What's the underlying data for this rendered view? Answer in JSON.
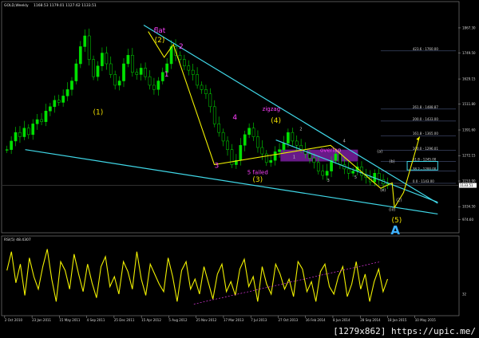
{
  "header": {
    "symbol": "GOLD,Weekly",
    "quote": "1168.53 1179.01 1127.62 1133.51",
    "osc": "RSI(5) 48.4307"
  },
  "watermark": "[1279x862] https://upic.me/",
  "colors": {
    "background": "#000000",
    "candle_up": "#00e000",
    "candle_down": "#00e000",
    "trendline": "#40d8e8",
    "wave": "#f0f000",
    "label_yellow": "#f0e000",
    "label_magenta": "#ff40ff",
    "label_gray": "#c8c8c8",
    "label_blue": "#3cb0ff",
    "overlap_box": "#7a1fa0",
    "osc_line": "#f0f000"
  },
  "chart_data": {
    "type": "candlestick",
    "title": "",
    "x_ticks": [
      "2 Oct 2010",
      "23 Jan 2011",
      "15 May 2011",
      "4 Sep 2011",
      "25 Dec 2011",
      "15 Apr 2012",
      "5 Aug 2012",
      "25 Nov 2012",
      "17 Mar 2013",
      "7 Jul 2013",
      "27 Oct 2013",
      "16 Feb 2014",
      "8 Jun 2014",
      "28 Sep 2014",
      "18 Jan 2015",
      "10 May 2015"
    ],
    "y_ticks": [
      1867.3,
      1749.5,
      1629.15,
      1511.8,
      1391.6,
      1272.15,
      1153.9,
      1034.5,
      974.6
    ],
    "ylim": [
      920,
      1960
    ],
    "current_price": 1133.51,
    "fib_levels": [
      {
        "label": "423.6",
        "value": 1760
      },
      {
        "label": "261.8",
        "value": 1488.87
      },
      {
        "label": "200.0",
        "value": 1433
      },
      {
        "label": "161.8",
        "value": 1365
      },
      {
        "label": "100.0",
        "value": 1296.01
      },
      {
        "label": "61.8",
        "value": 1245
      },
      {
        "label": "38.2",
        "value": 1200
      },
      {
        "label": "0.0",
        "value": 1143
      }
    ],
    "series": [
      {
        "name": "GOLD Weekly close",
        "values": [
          1300,
          1340,
          1380,
          1360,
          1400,
          1370,
          1420,
          1440,
          1430,
          1480,
          1500,
          1530,
          1520,
          1550,
          1580,
          1620,
          1700,
          1780,
          1830,
          1720,
          1640,
          1690,
          1750,
          1700,
          1650,
          1600,
          1620,
          1700,
          1740,
          1660,
          1650,
          1680,
          1640,
          1600,
          1580,
          1620,
          1660,
          1700,
          1780,
          1740,
          1720,
          1690,
          1670,
          1650,
          1600,
          1580,
          1560,
          1500,
          1420,
          1380,
          1340,
          1300,
          1230,
          1250,
          1320,
          1370,
          1400,
          1360,
          1310,
          1280,
          1240,
          1250,
          1290,
          1300,
          1330,
          1380,
          1340,
          1320,
          1300,
          1280,
          1260,
          1240,
          1200,
          1180,
          1200,
          1250,
          1280,
          1230,
          1210,
          1190,
          1200,
          1220,
          1180,
          1170,
          1150,
          1190,
          1160,
          1140,
          1133
        ]
      }
    ],
    "rsi": {
      "name": "RSI(5)",
      "current": 48.4307,
      "level_label": "32",
      "values": [
        55,
        70,
        45,
        60,
        35,
        65,
        50,
        40,
        58,
        72,
        48,
        30,
        62,
        55,
        40,
        68,
        52,
        38,
        60,
        45,
        33,
        58,
        66,
        42,
        50,
        36,
        62,
        54,
        40,
        70,
        48,
        35,
        60,
        52,
        44,
        38,
        65,
        50,
        30,
        55,
        62,
        40,
        48,
        36,
        58,
        45,
        32,
        52,
        60,
        38,
        46,
        35,
        56,
        64,
        42,
        50,
        30,
        58,
        44,
        36,
        60,
        52,
        40,
        48,
        34,
        62,
        56,
        38,
        46,
        30,
        54,
        60,
        42,
        36,
        50,
        58,
        34,
        44,
        62,
        40,
        52,
        30,
        46,
        56,
        38,
        48
      ]
    },
    "annotations": [
      {
        "text": "flat",
        "color": "magenta",
        "x": 0.345,
        "y": 1845
      },
      {
        "text": "(2)",
        "color": "yellow",
        "x": 0.345,
        "y": 1800
      },
      {
        "text": "2",
        "color": "magenta",
        "x": 0.392,
        "y": 1770
      },
      {
        "text": "1",
        "color": "magenta",
        "x": 0.36,
        "y": 1640
      },
      {
        "text": "(1)",
        "color": "yellow",
        "x": 0.21,
        "y": 1465
      },
      {
        "text": "3",
        "color": "magenta",
        "x": 0.47,
        "y": 1215
      },
      {
        "text": "4",
        "color": "magenta",
        "x": 0.51,
        "y": 1440
      },
      {
        "text": "zigzag",
        "color": "magenta",
        "x": 0.59,
        "y": 1480
      },
      {
        "text": "(4)",
        "color": "yellow",
        "x": 0.6,
        "y": 1425
      },
      {
        "text": "2",
        "color": "gray",
        "x": 0.655,
        "y": 1390
      },
      {
        "text": "1",
        "color": "gray",
        "x": 0.64,
        "y": 1260
      },
      {
        "text": "overlap",
        "color": "magenta",
        "x": 0.72,
        "y": 1290
      },
      {
        "text": "4",
        "color": "gray",
        "x": 0.75,
        "y": 1335
      },
      {
        "text": "5 failed",
        "color": "magenta",
        "x": 0.56,
        "y": 1185
      },
      {
        "text": "(3)",
        "color": "yellow",
        "x": 0.56,
        "y": 1150
      },
      {
        "text": "3",
        "color": "gray",
        "x": 0.715,
        "y": 1150
      },
      {
        "text": "5",
        "color": "gray",
        "x": 0.775,
        "y": 1165
      },
      {
        "text": "(a)",
        "color": "gray",
        "x": 0.828,
        "y": 1285
      },
      {
        "text": "(b)",
        "color": "gray",
        "x": 0.855,
        "y": 1240
      },
      {
        "text": "(e)",
        "color": "gray",
        "x": 0.835,
        "y": 1105
      },
      {
        "text": "(iii)",
        "color": "gray",
        "x": 0.855,
        "y": 1015
      },
      {
        "text": "(2)",
        "color": "gray",
        "x": 0.87,
        "y": 1060
      },
      {
        "text": "(5)",
        "color": "yellow",
        "x": 0.865,
        "y": 960
      },
      {
        "text": "A",
        "color": "blue",
        "x": 0.862,
        "y": 905
      }
    ]
  }
}
